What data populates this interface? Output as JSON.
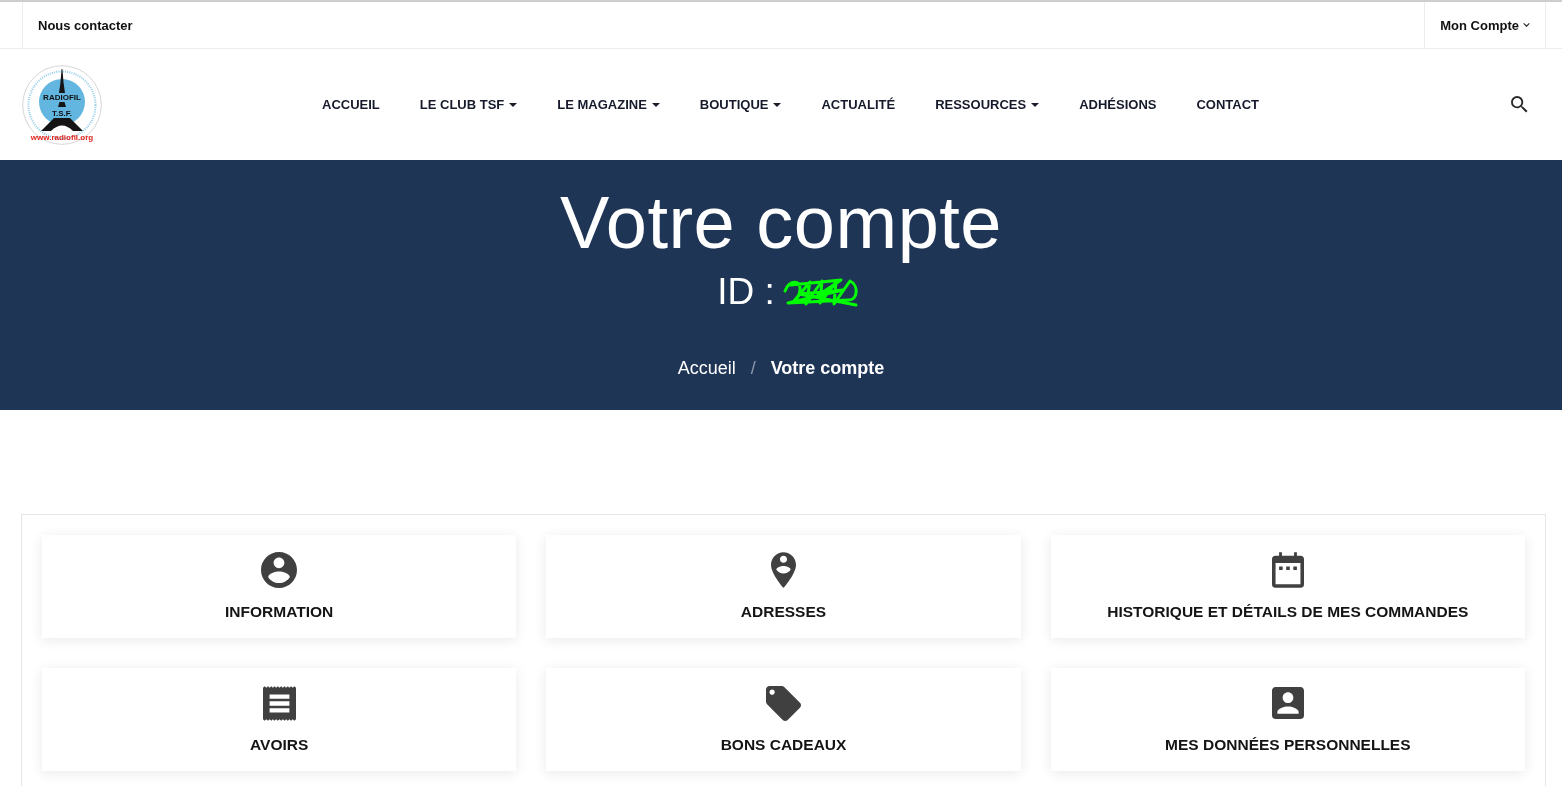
{
  "top_bar": {
    "contact_link": "Nous contacter",
    "account_menu": {
      "label": "Mon Compte",
      "dropdown": true
    }
  },
  "header": {
    "logo": {
      "name": "RADIOFIL",
      "subtitle": "T.S.F.",
      "website": "www.radiofil.org"
    },
    "nav": [
      {
        "label": "ACCUEIL",
        "dropdown": false
      },
      {
        "label": "LE CLUB TSF",
        "dropdown": true
      },
      {
        "label": "LE MAGAZINE",
        "dropdown": true
      },
      {
        "label": "BOUTIQUE",
        "dropdown": true
      },
      {
        "label": "ACTUALITÉ",
        "dropdown": false
      },
      {
        "label": "RESSOURCES",
        "dropdown": true
      },
      {
        "label": "ADHÉSIONS",
        "dropdown": false
      },
      {
        "label": "CONTACT",
        "dropdown": false
      }
    ]
  },
  "hero": {
    "title": "Votre compte",
    "id_label": "ID :",
    "breadcrumb": {
      "separator": "/",
      "items": [
        {
          "label": "Accueil",
          "current": false
        },
        {
          "label": "Votre compte",
          "current": true
        }
      ]
    }
  },
  "account_sections": [
    {
      "label": "INFORMATION",
      "kind": "profile"
    },
    {
      "label": "ADRESSES",
      "kind": "address"
    },
    {
      "label": "HISTORIQUE ET DÉTAILS DE MES COMMANDES",
      "kind": "orders"
    },
    {
      "label": "AVOIRS",
      "kind": "credit"
    },
    {
      "label": "BONS CADEAUX",
      "kind": "voucher"
    },
    {
      "label": "MES DONNÉES PERSONNELLES",
      "kind": "personal"
    }
  ]
}
